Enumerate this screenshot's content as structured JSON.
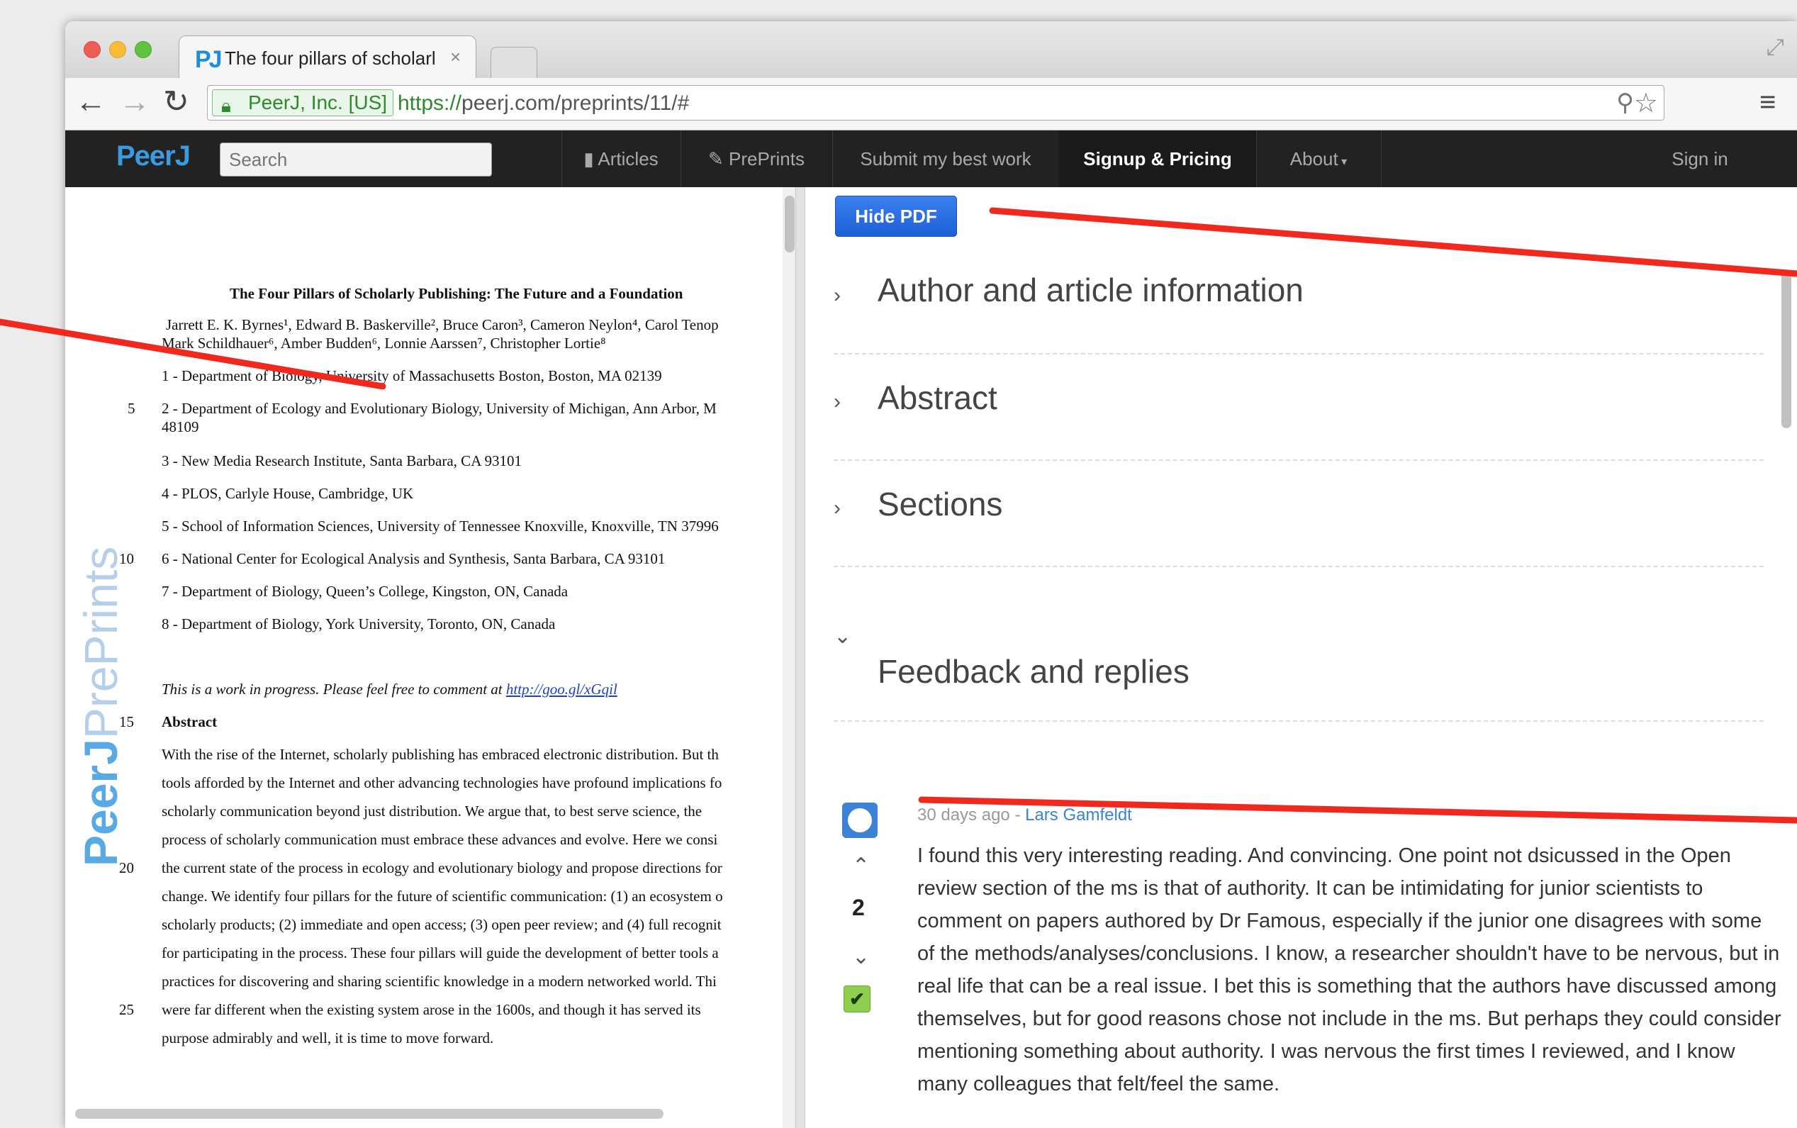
{
  "browser": {
    "tab_title": "The four pillars of scholarl",
    "tab_favicon": "PJ",
    "tab_close": "×",
    "ev_label": "PeerJ, Inc. [US]",
    "url_scheme": "https://",
    "url_rest": "peerj.com/preprints/11/#"
  },
  "navbar": {
    "brand": "PeerJ",
    "search_placeholder": "Search",
    "items": [
      {
        "label": "Articles",
        "icon": "document-icon"
      },
      {
        "label": "PrePrints",
        "icon": "pencil-icon"
      },
      {
        "label": "Submit my best work"
      },
      {
        "label": "Signup & Pricing"
      },
      {
        "label": "About",
        "icon": "caret-down-icon"
      }
    ],
    "sign_in": "Sign in"
  },
  "pdf": {
    "watermark_bold": "PeerJ",
    "watermark_thin": "PrePrints",
    "title": "The Four Pillars of Scholarly Publishing: The Future and a Foundation",
    "lines": [
      {
        "num": "",
        "text": "Jarrett E. K. Byrnes¹, Edward B. Baskerville², Bruce Caron³, Cameron Neylon⁴, Carol Tenop"
      },
      {
        "num": "",
        "text": "Mark Schildhauer⁶, Amber Budden⁶, Lonnie Aarssen⁷, Christopher Lortie⁸"
      },
      {
        "num": "",
        "text": "1 - Department of Biology, University of Massachusetts Boston, Boston, MA 02139"
      },
      {
        "num": "5",
        "text": "2 - Department of Ecology and Evolutionary Biology, University of Michigan, Ann Arbor, M"
      },
      {
        "num": "",
        "text": "48109"
      },
      {
        "num": "",
        "text": "3 - New Media Research Institute, Santa Barbara, CA 93101"
      },
      {
        "num": "",
        "text": "4 - PLOS, Carlyle House, Cambridge, UK"
      },
      {
        "num": "",
        "text": "5 - School of Information Sciences, University of Tennessee Knoxville, Knoxville, TN 37996"
      },
      {
        "num": "10",
        "text": "6 - National Center for Ecological Analysis and Synthesis, Santa Barbara, CA 93101"
      },
      {
        "num": "",
        "text": "7 - Department of Biology, Queen’s College, Kingston, ON, Canada"
      },
      {
        "num": "",
        "text": "8 - Department of Biology, York University, Toronto, ON, Canada"
      }
    ],
    "wip_text": "This is a work in progress.  Please feel free to comment at ",
    "wip_link": "http://goo.gl/xGqil",
    "abstract_num": "15",
    "abstract_heading": "Abstract",
    "abstract_lines": [
      {
        "num": "",
        "text": "With the rise of the Internet, scholarly publishing has embraced electronic distribution.  But th"
      },
      {
        "num": "",
        "text": "tools afforded by the Internet and other advancing technologies have profound implications fo"
      },
      {
        "num": "",
        "text": "scholarly communication beyond just distribution. We argue that, to best serve science, the"
      },
      {
        "num": "",
        "text": "process of scholarly communication must embrace these advances and evolve. Here we consi"
      },
      {
        "num": "20",
        "text": "the current state of the process in ecology and evolutionary biology and propose directions for"
      },
      {
        "num": "",
        "text": "change. We identify four pillars for the future of scientific communication: (1) an ecosystem o"
      },
      {
        "num": "",
        "text": "scholarly products; (2) immediate and open access; (3) open peer review; and (4) full recognit"
      },
      {
        "num": "",
        "text": "for participating in the process. These four pillars will guide the development of better tools a"
      },
      {
        "num": "",
        "text": "practices for discovering and sharing scientific knowledge in a modern networked world. Thi"
      },
      {
        "num": "25",
        "text": "were far different when the existing system arose in the 1600s, and though it has served its"
      },
      {
        "num": "",
        "text": "purpose admirably and well, it is time to move forward."
      }
    ]
  },
  "right": {
    "hide_pdf": "Hide PDF",
    "sections": [
      {
        "label": "Author and article information",
        "chevron": "›"
      },
      {
        "label": "Abstract",
        "chevron": "›"
      },
      {
        "label": "Sections",
        "chevron": "›"
      },
      {
        "label": "Feedback and replies",
        "chevron": "⌄"
      }
    ],
    "feedback": {
      "meta_time": "30 days ago",
      "meta_sep": " - ",
      "author": "Lars Gamfeldt",
      "votes": "2",
      "accepted": "✔",
      "comment": "I found this very interesting reading. And convincing. One point not dsicussed in the Open review section of the ms is that of authority. It can be intimidating for junior scientists to comment on papers authored by Dr Famous, especially if the junior one disagrees with some of the methods/analyses/conclusions. I know, a researcher shouldn't have to be nervous, but in real life that can be a real issue. I bet this is something that the authors have discussed among themselves, but for good reasons chose not include in the ms. But perhaps they could consider mentioning something about authority. I was nervous the first times I reviewed, and I know many colleagues that felt/feel the same."
    }
  },
  "colors": {
    "accent": "#3b9be0",
    "button": "#1d5fd6",
    "annotation": "#f0281e"
  }
}
